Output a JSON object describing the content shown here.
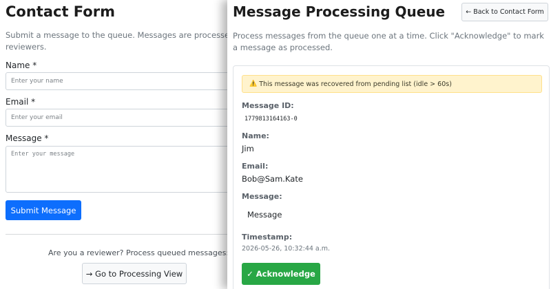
{
  "contact_form": {
    "title": "Contact Form",
    "intro": "Submit a message to the queue. Messages are processed in order by reviewers.",
    "name_label": "Name *",
    "name_placeholder": "Enter your name",
    "email_label": "Email *",
    "email_placeholder": "Enter your email",
    "message_label": "Message *",
    "message_placeholder": "Enter your message",
    "submit_label": "Submit Message",
    "reviewer_prompt": "Are you a reviewer? Process queued messages:",
    "goto_label": "→ Go to Processing View"
  },
  "processing": {
    "title": "Message Processing Queue",
    "back_label": "← Back to Contact Form",
    "intro": "Process messages from the queue one at a time. Click \"Acknowledge\" to mark a message as processed.",
    "warning_icon": "⚠️",
    "warning_text": "This message was recovered from pending list (idle > 60s)",
    "id_label": "Message ID:",
    "id_value": "1779813164163-0",
    "name_label": "Name:",
    "name_value": "Jim",
    "email_label": "Email:",
    "email_value": "Bob@Sam.Kate",
    "message_label": "Message:",
    "message_value": "Message",
    "timestamp_label": "Timestamp:",
    "timestamp_value": "2026-05-26, 10:32:44 a.m.",
    "ack_label": "✓ Acknowledge"
  },
  "colors": {
    "primary": "#0d6efd",
    "success": "#28a745",
    "warning_bg": "#fff3cd",
    "warning_border": "#ffe08a"
  }
}
